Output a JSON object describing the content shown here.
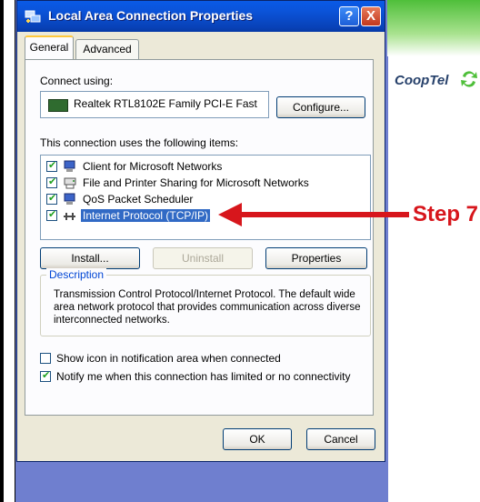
{
  "window": {
    "title": "Local Area Connection Properties",
    "help_label": "?",
    "close_label": "X"
  },
  "tabs": [
    {
      "label": "General",
      "active": true
    },
    {
      "label": "Advanced",
      "active": false
    }
  ],
  "connect_using": {
    "label": "Connect using:",
    "adapter": "Realtek RTL8102E Family PCI-E Fast",
    "configure_label": "Configure..."
  },
  "items_section": {
    "label": "This connection uses the following items:",
    "items": [
      {
        "label": "Client for Microsoft Networks",
        "checked": true,
        "icon": "network-client-icon"
      },
      {
        "label": "File and Printer Sharing for Microsoft Networks",
        "checked": true,
        "icon": "file-printer-sharing-icon"
      },
      {
        "label": "QoS Packet Scheduler",
        "checked": true,
        "icon": "qos-scheduler-icon"
      },
      {
        "label": "Internet Protocol (TCP/IP)",
        "checked": true,
        "selected": true,
        "icon": "protocol-icon"
      }
    ]
  },
  "buttons": {
    "install": "Install...",
    "uninstall": "Uninstall",
    "properties": "Properties",
    "ok": "OK",
    "cancel": "Cancel"
  },
  "description": {
    "title": "Description",
    "text": "Transmission Control Protocol/Internet Protocol. The default wide area network protocol that provides communication across diverse interconnected networks."
  },
  "options": [
    {
      "label": "Show icon in notification area when connected",
      "checked": false
    },
    {
      "label": "Notify me when this connection has limited or no connectivity",
      "checked": true
    }
  ],
  "branding": {
    "logo_text": "CoopTel",
    "step_label": "Step 7",
    "accent_color": "#d7161c"
  }
}
